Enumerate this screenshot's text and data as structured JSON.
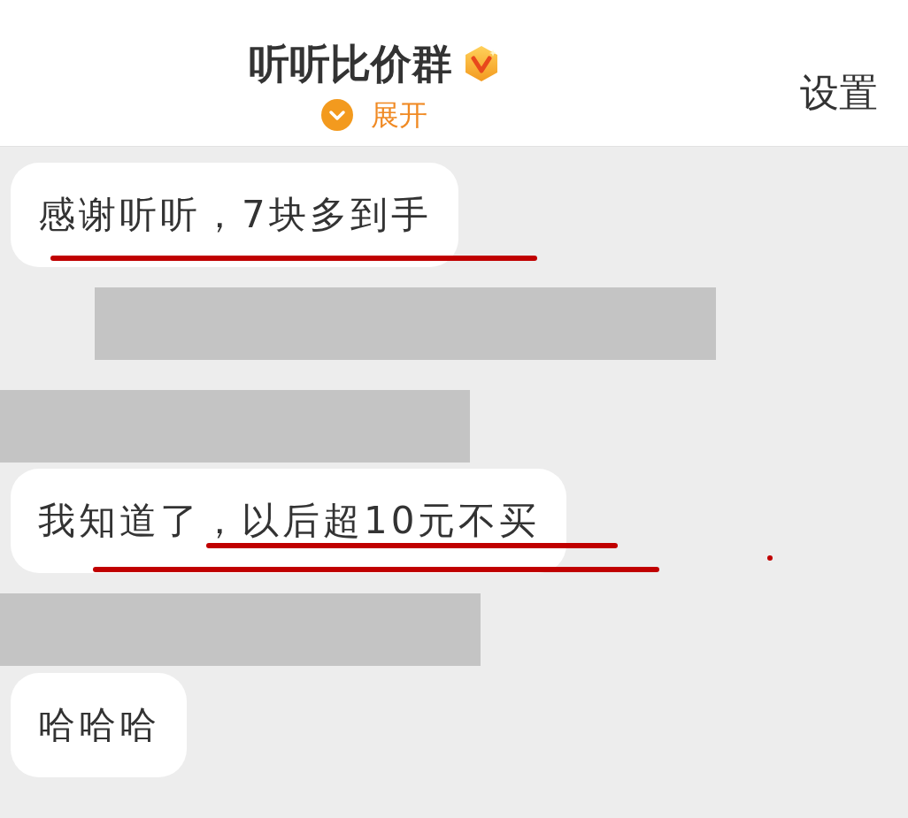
{
  "header": {
    "title": "听听比价群",
    "verified": true,
    "expand": {
      "label": "展开"
    },
    "settings": {
      "label": "设置"
    }
  },
  "messages": [
    {
      "kind": "bubble",
      "text": "感谢听听，7块多到手",
      "annotations": [
        {
          "kind": "underline"
        }
      ]
    },
    {
      "kind": "redacted"
    },
    {
      "kind": "redacted"
    },
    {
      "kind": "bubble",
      "text": "我知道了，以后超10元不买",
      "annotations": [
        {
          "kind": "underline"
        },
        {
          "kind": "underline"
        },
        {
          "kind": "dot"
        }
      ]
    },
    {
      "kind": "redacted"
    },
    {
      "kind": "bubble",
      "text": "哈哈哈"
    }
  ]
}
